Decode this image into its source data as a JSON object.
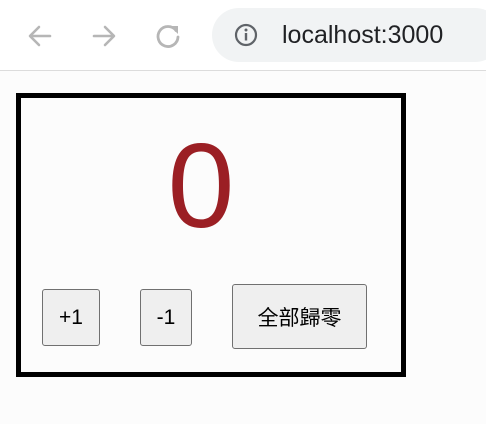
{
  "browser": {
    "url": "localhost:3000",
    "back_icon": "arrow-left-icon",
    "forward_icon": "arrow-right-icon",
    "reload_icon": "reload-icon",
    "info_icon": "info-circle-icon"
  },
  "counter": {
    "value": "0",
    "value_color": "#9b1f24",
    "increment_label": "+1",
    "decrement_label": "-1",
    "reset_label": "全部歸零"
  }
}
